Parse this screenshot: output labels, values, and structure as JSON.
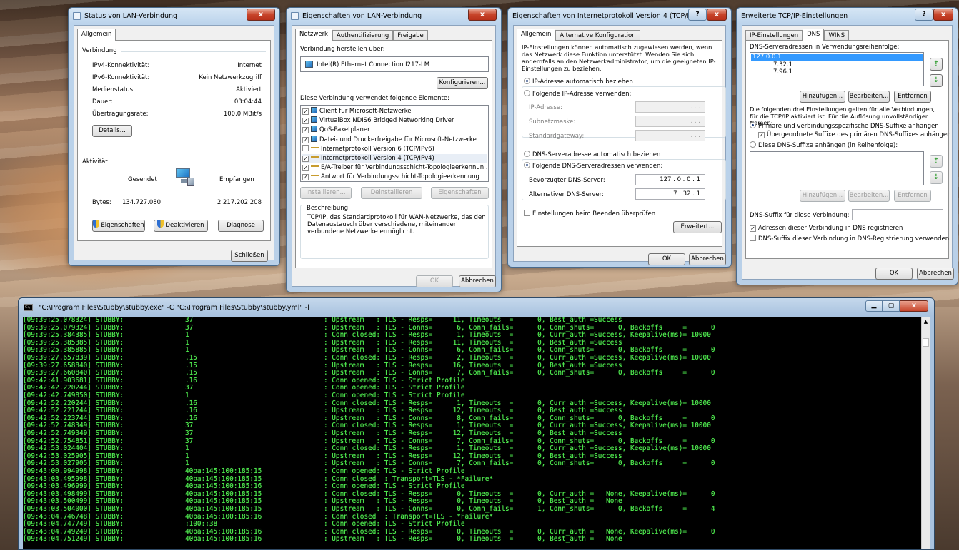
{
  "status_window": {
    "title": "Status von LAN-Verbindung",
    "close": "x",
    "tab": "Allgemein",
    "connection_group": "Verbindung",
    "rows": [
      {
        "label": "IPv4-Konnektivität:",
        "value": "Internet"
      },
      {
        "label": "IPv6-Konnektivität:",
        "value": "Kein Netzwerkzugriff"
      },
      {
        "label": "Medienstatus:",
        "value": "Aktiviert"
      },
      {
        "label": "Dauer:",
        "value": "03:04:44"
      },
      {
        "label": "Übertragungsrate:",
        "value": "100,0 MBit/s"
      }
    ],
    "details_btn": "Details...",
    "activity_group": "Aktivität",
    "sent": "Gesendet",
    "received": "Empfangen",
    "bytes_label": "Bytes:",
    "bytes_sent": "134.727.080",
    "bytes_received": "2.217.202.208",
    "btn_properties": "Eigenschaften",
    "btn_disable": "Deaktivieren",
    "btn_diagnose": "Diagnose",
    "btn_close": "Schließen"
  },
  "props_window": {
    "title": "Eigenschaften von LAN-Verbindung",
    "close": "x",
    "tabs": [
      "Netzwerk",
      "Authentifizierung",
      "Freigabe"
    ],
    "connect_using_label": "Verbindung herstellen über:",
    "adapter": "Intel(R) Ethernet Connection I217-LM",
    "configure_btn": "Konfigurieren...",
    "items_label": "Diese Verbindung verwendet folgende Elemente:",
    "items": [
      {
        "label": "Client für Microsoft-Netzwerke",
        "checked": true
      },
      {
        "label": "VirtualBox NDIS6 Bridged Networking Driver",
        "checked": true
      },
      {
        "label": "QoS-Paketplaner",
        "checked": true
      },
      {
        "label": "Datei- und Druckerfreigabe für Microsoft-Netzwerke",
        "checked": true
      },
      {
        "label": "Internetprotokoll Version 6 (TCP/IPv6)",
        "checked": false
      },
      {
        "label": "Internetprotokoll Version 4 (TCP/IPv4)",
        "checked": true
      },
      {
        "label": "E/A-Treiber für Verbindungsschicht-Topologieerkennun...",
        "checked": true
      },
      {
        "label": "Antwort für Verbindungsschicht-Topologieerkennung",
        "checked": true
      }
    ],
    "install_btn": "Installieren...",
    "uninstall_btn": "Deinstallieren",
    "properties_btn": "Eigenschaften",
    "description_title": "Beschreibung",
    "description": "TCP/IP, das Standardprotokoll für WAN-Netzwerke, das den Datenaustausch über verschiedene, miteinander verbundene Netzwerke ermöglicht.",
    "ok_btn": "OK",
    "cancel_btn": "Abbrechen"
  },
  "ipv4_window": {
    "title": "Eigenschaften von Internetprotokoll Version 4 (TCP/IPv4)",
    "help": "?",
    "close": "x",
    "tabs": [
      "Allgemein",
      "Alternative Konfiguration"
    ],
    "intro": "IP-Einstellungen können automatisch zugewiesen werden, wenn das Netzwerk diese Funktion unterstützt. Wenden Sie sich andernfalls an den Netzwerkadministrator, um die geeigneten IP-Einstellungen zu beziehen.",
    "auto_ip": "IP-Adresse automatisch beziehen",
    "manual_ip": "Folgende IP-Adresse verwenden:",
    "ip_label": "IP-Adresse:",
    "mask_label": "Subnetzmaske:",
    "gateway_label": "Standardgateway:",
    "empty_ip": ".      .      .",
    "auto_dns": "DNS-Serveradresse automatisch beziehen",
    "manual_dns": "Folgende DNS-Serveradressen verwenden:",
    "preferred_label": "Bevorzugter DNS-Server:",
    "preferred_value": "127 .  0  .  0  .  1",
    "alternate_label": "Alternativer DNS-Server:",
    "alternate_value": "7 .  32  .  1",
    "validate": "Einstellungen beim Beenden überprüfen",
    "advanced_btn": "Erweitert...",
    "ok_btn": "OK",
    "cancel_btn": "Abbrechen"
  },
  "tcpip_window": {
    "title": "Erweiterte TCP/IP-Einstellungen",
    "help": "?",
    "close": "x",
    "tabs": [
      "IP-Einstellungen",
      "DNS",
      "WINS"
    ],
    "dns_list_label": "DNS-Serveradressen in Verwendungsreihenfolge:",
    "dns_list": [
      "127.0.0.1",
      "7.32.1",
      "7.96.1"
    ],
    "add_btn": "Hinzufügen...",
    "edit_btn": "Bearbeiten...",
    "remove_btn": "Entfernen",
    "info": "Die folgenden drei Einstellungen gelten für alle Verbindungen, für die TCP/IP aktiviert ist. Für die Auflösung unvollständiger Namen:",
    "opt_primary": "Primäre und verbindungsspezifische DNS-Suffixe anhängen",
    "opt_parent": "Übergeordnete Suffixe des primären DNS-Suffixes anhängen",
    "opt_append": "Diese DNS-Suffixe anhängen (in Reihenfolge):",
    "suffix_label": "DNS-Suffix für diese Verbindung:",
    "register": "Adressen dieser Verbindung in DNS registrieren",
    "use_suffix": "DNS-Suffix dieser Verbindung in DNS-Registrierung verwenden",
    "ok_btn": "OK",
    "cancel_btn": "Abbrechen"
  },
  "console": {
    "title": "\"C:\\Program Files\\Stubby\\stubby.exe\" -C \"C:\\Program Files\\Stubby\\stubby.yml\" -l",
    "lines": [
      [
        "[09:39:25.078324] STUBBY:",
        "37",
        ": Upstream   : TLS - Resps=     11, Timeouts  =      0, Best_auth =Success"
      ],
      [
        "[09:39:25.079324] STUBBY:",
        "37",
        ": Upstream   : TLS - Conns=      6, Conn_fails=      0, Conn_shuts=      0, Backoffs     =      0"
      ],
      [
        "[09:39:25.384385] STUBBY:",
        "1",
        ": Conn closed: TLS - Resps=      1, Timeouts  =      0, Curr_auth =Success, Keepalive(ms)= 10000"
      ],
      [
        "[09:39:25.385385] STUBBY:",
        "1",
        ": Upstream   : TLS - Resps=     11, Timeouts  =      0, Best_auth =Success"
      ],
      [
        "[09:39:25.385885] STUBBY:",
        "1",
        ": Upstream   : TLS - Conns=      6, Conn_fails=      0, Conn_shuts=      0, Backoffs     =      0"
      ],
      [
        "[09:39:27.657839] STUBBY:",
        ".15",
        ": Conn closed: TLS - Resps=      2, Timeouts  =      0, Curr_auth =Success, Keepalive(ms)= 10000"
      ],
      [
        "[09:39:27.658840] STUBBY:",
        ".15",
        ": Upstream   : TLS - Resps=     16, Timeouts  =      0, Best_auth =Success"
      ],
      [
        "[09:39:27.660840] STUBBY:",
        ".15",
        ": Upstream   : TLS - Conns=      7, Conn_fails=      0, Conn_shuts=      0, Backoffs     =      0"
      ],
      [
        "[09:42:41.903681] STUBBY:",
        ".16",
        ": Conn opened: TLS - Strict Profile",
        ""
      ],
      [
        "[09:42:42.220244] STUBBY:",
        "37",
        ": Conn opened: TLS - Strict Profile"
      ],
      [
        "[09:42:42.749850] STUBBY:",
        "1",
        ": Conn opened: TLS - Strict Profile"
      ],
      [
        "[09:42:52.220244] STUBBY:",
        ".16",
        ": Conn closed: TLS - Resps=      1, Timeouts  =      0, Curr_auth =Success, Keepalive(ms)= 10000"
      ],
      [
        "[09:42:52.221244] STUBBY:",
        ".16",
        ": Upstream   : TLS - Resps=     12, Timeouts  =      0, Best_auth =Success"
      ],
      [
        "[09:42:52.223744] STUBBY:",
        ".16",
        ": Upstream   : TLS - Conns=      8, Conn_fails=      0, Conn_shuts=      0, Backoffs     =      0"
      ],
      [
        "[09:42:52.748349] STUBBY:",
        "37",
        ": Conn closed: TLS - Resps=      1, Timeouts  =      0, Curr_auth =Success, Keepalive(ms)= 10000"
      ],
      [
        "[09:42:52.749349] STUBBY:",
        "37",
        ": Upstream   : TLS - Resps=     12, Timeouts  =      0, Best_auth =Success"
      ],
      [
        "[09:42:52.754851] STUBBY:",
        "37",
        ": Upstream   : TLS - Conns=      7, Conn_fails=      0, Conn_shuts=      0, Backoffs     =      0"
      ],
      [
        "[09:42:53.024404] STUBBY:",
        "1",
        ": Conn closed: TLS - Resps=      1, Timeouts  =      0, Curr_auth =Success, Keepalive(ms)= 10000"
      ],
      [
        "[09:42:53.025905] STUBBY:",
        "1",
        ": Upstream   : TLS - Resps=     12, Timeouts  =      0, Best_auth =Success"
      ],
      [
        "[09:42:53.027905] STUBBY:",
        "1",
        ": Upstream   : TLS - Conns=      7, Conn_fails=      0, Conn_shuts=      0, Backoffs     =      0"
      ],
      [
        "[09:43:00.994998] STUBBY:",
        "40ba:145:100:185:15",
        ": Conn opened: TLS - Strict Profile"
      ],
      [
        "[09:43:03.495998] STUBBY:",
        "40ba:145:100:185:15",
        ": Conn closed  : Transport=TLS - *Failure*"
      ],
      [
        "[09:43:03.496999] STUBBY:",
        "40ba:145:100:185:16",
        ": Conn opened: TLS - Strict Profile"
      ],
      [
        "[09:43:03.498499] STUBBY:",
        "40ba:145:100:185:15",
        ": Conn closed: TLS - Resps=      0, Timeouts  =      0, Curr_auth =   None, Keepalive(ms)=      0"
      ],
      [
        "[09:43:03.500499] STUBBY:",
        "40ba:145:100:185:15",
        ": Upstream   : TLS - Resps=      0, Timeouts  =      0, Best_auth =   None"
      ],
      [
        "[09:43:03.504000] STUBBY:",
        "40ba:145:100:185:15",
        ": Upstream   : TLS - Conns=      0, Conn_fails=      1, Conn_shuts=      0, Backoffs     =      4"
      ],
      [
        "[09:43:04.746748] STUBBY:",
        "40ba:145:100:185:16",
        ": Conn closed  : Transport=TLS - *Failure*"
      ],
      [
        "[09:43:04.747749] STUBBY:",
        ":100::38",
        ": Conn opened: TLS - Strict Profile"
      ],
      [
        "[09:43:04.749249] STUBBY:",
        "40ba:145:100:185:16",
        ": Conn closed: TLS - Resps=      0, Timeouts  =      0, Curr_auth =   None, Keepalive(ms)=      0"
      ],
      [
        "[09:43:04.751249] STUBBY:",
        "40ba:145:100:185:16",
        ": Upstream   : TLS - Resps=      0, Timeouts  =      0, Best_auth =   None"
      ]
    ]
  }
}
